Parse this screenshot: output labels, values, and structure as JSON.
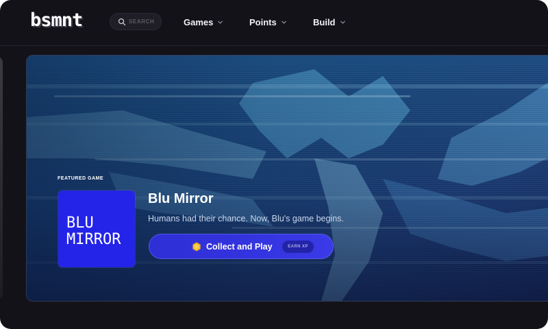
{
  "nav": {
    "logo": "bsmnt",
    "search_placeholder": "SEARCH",
    "items": [
      {
        "label": "Games"
      },
      {
        "label": "Points"
      },
      {
        "label": "Build"
      }
    ]
  },
  "hero": {
    "featured_label": "FEATURED GAME",
    "thumbnail_text": "BLU\nMIRROR",
    "title": "Blu Mirror",
    "description": "Humans had their chance. Now, Blu's game begins.",
    "cta_label": "Collect and Play",
    "cta_badge": "EARN XP"
  },
  "colors": {
    "background": "#141219",
    "accent_blue": "#2424e8",
    "coin": "#f5b21c"
  },
  "icons": {
    "search": "search-icon",
    "chevron": "chevron-down-icon",
    "coin": "coin-icon"
  }
}
